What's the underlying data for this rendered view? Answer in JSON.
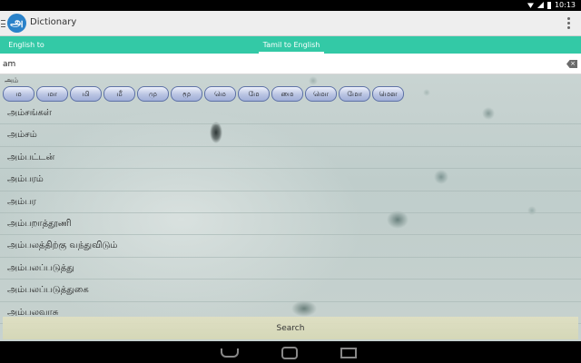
{
  "status_bar": {
    "time": "10:13"
  },
  "app": {
    "title": "Dictionary",
    "logo_glyph": "அ"
  },
  "tabs": [
    {
      "label": "English to Tamil",
      "active": false
    },
    {
      "label": "Tamil to English",
      "active": true
    }
  ],
  "search": {
    "value": "am",
    "placeholder": ""
  },
  "results_header": "அம்",
  "letters": [
    "ம",
    "மா",
    "மி",
    "மீ",
    "மு",
    "மூ",
    "மெ",
    "மே",
    "மை",
    "மொ",
    "மோ",
    "மௌ"
  ],
  "words": [
    "அம்சங்கள்",
    "அம்சம்",
    "அம்பட்டன்",
    "அம்பரம்",
    "அம்பர",
    "அம்பறாத்தூணி",
    "அம்பலத்திற்கு வந்துவிடும்",
    "அம்பலப்படுத்து",
    "அம்பலப்படுத்துகை",
    "அம்பலவாசு"
  ],
  "search_button": "Search",
  "colors": {
    "tab_bar": "#33c9a6",
    "logo": "#2a82c9",
    "action_bar": "#eeeeee"
  },
  "icons": [
    "drawer-icon",
    "overflow-menu-icon",
    "clear-icon",
    "back-icon",
    "home-icon",
    "recent-apps-icon"
  ]
}
